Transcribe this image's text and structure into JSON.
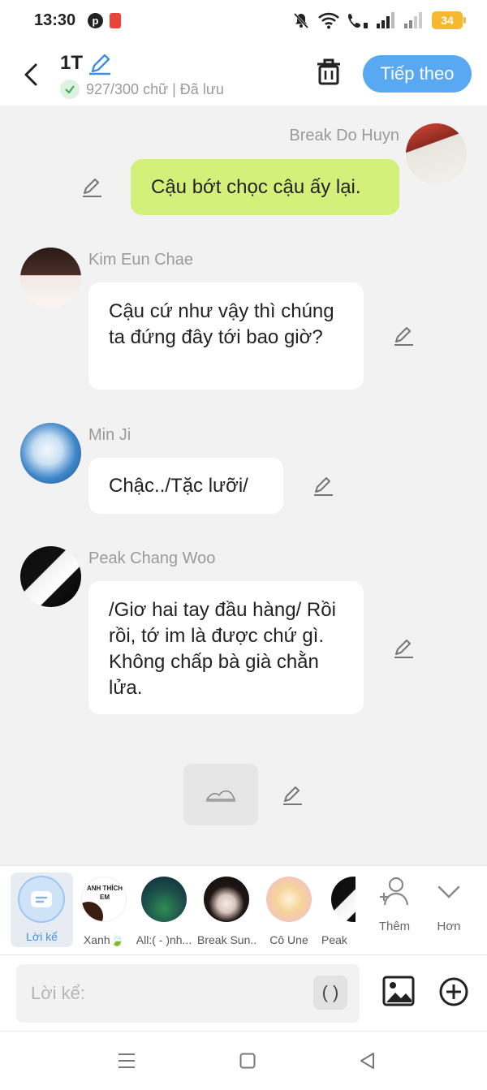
{
  "status_bar": {
    "time": "13:30",
    "battery": "34",
    "left_icons": [
      "pinterest-icon",
      "wallet-app-icon"
    ],
    "right_icons": [
      "mute-icon",
      "wifi-icon",
      "wifi-call-icon",
      "signal-icon",
      "signal-icon",
      "battery-icon"
    ]
  },
  "header": {
    "title": "1T",
    "subtitle": "927/300 chữ | Đã lưu",
    "next_label": "Tiếp theo"
  },
  "messages": [
    {
      "author": "Break Do Huyn",
      "text": "Cậu bớt chọc cậu ấy lại.",
      "side": "right",
      "bubble_color": "#d3f17a"
    },
    {
      "author": "Kim Eun Chae",
      "text": "Cậu cứ như vậy thì chúng ta đứng đây tới bao giờ?",
      "side": "left"
    },
    {
      "author": "Min Ji",
      "text": "Chậc../Tặc lưỡi/",
      "side": "left"
    },
    {
      "author": "Peak Chang Woo",
      "text": "/Giơ hai tay đầu hàng/ Rồi rồi, tớ im là được chứ gì. Không chấp bà già chằn lửa.",
      "side": "left"
    }
  ],
  "characters": {
    "narrator_label": "Lời kể",
    "items": [
      {
        "label": "Xanh🍃",
        "avatar_text": "ANH THÍCH EM"
      },
      {
        "label": "All:( - )nh..."
      },
      {
        "label": "Break Sun..."
      },
      {
        "label": "Cô Une"
      },
      {
        "label": "Peak"
      }
    ],
    "add_label": "Thêm",
    "more_label": "Hơn"
  },
  "composer": {
    "placeholder": "Lời kể:",
    "paren_label": "( )"
  },
  "colors": {
    "accent": "#59a8f2",
    "own_bubble": "#d3f17a",
    "background": "#f2f2f2"
  }
}
